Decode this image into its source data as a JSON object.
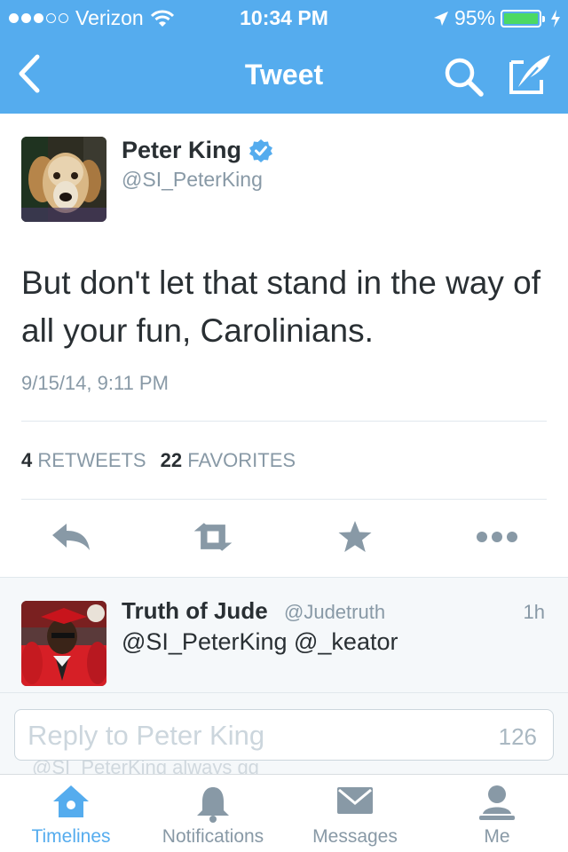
{
  "status_bar": {
    "carrier": "Verizon",
    "time": "10:34 PM",
    "battery_percent": "95%",
    "signal_bars": 3
  },
  "nav": {
    "title": "Tweet",
    "back_icon": "chevron-left-icon",
    "search_icon": "search-icon",
    "compose_icon": "compose-icon"
  },
  "tweet": {
    "author_name": "Peter King",
    "verified": true,
    "author_handle": "@SI_PeterKing",
    "text": "But don't let that stand in the way of all your fun, Carolinians.",
    "timestamp": "9/15/14, 9:11 PM",
    "retweets_count": "4",
    "retweets_label": "RETWEETS",
    "favorites_count": "22",
    "favorites_label": "FAVORITES",
    "actions": [
      "reply-icon",
      "retweet-icon",
      "favorite-icon",
      "more-icon"
    ]
  },
  "reply": {
    "author_name": "Truth of Jude",
    "author_handle": "@Judetruth",
    "age": "1h",
    "text": "@SI_PeterKing @_keator"
  },
  "composer": {
    "placeholder": "Reply to Peter King",
    "char_count": "126",
    "peek_text": "@SI_PeterKing always gg"
  },
  "tabbar": {
    "tabs": [
      {
        "label": "Timelines",
        "icon": "home-icon",
        "active": true
      },
      {
        "label": "Notifications",
        "icon": "bell-icon",
        "active": false
      },
      {
        "label": "Messages",
        "icon": "envelope-icon",
        "active": false
      },
      {
        "label": "Me",
        "icon": "person-icon",
        "active": false
      }
    ]
  },
  "colors": {
    "brand": "#55acee",
    "text": "#292f33",
    "muted": "#8899a6",
    "battery": "#4cd964"
  }
}
